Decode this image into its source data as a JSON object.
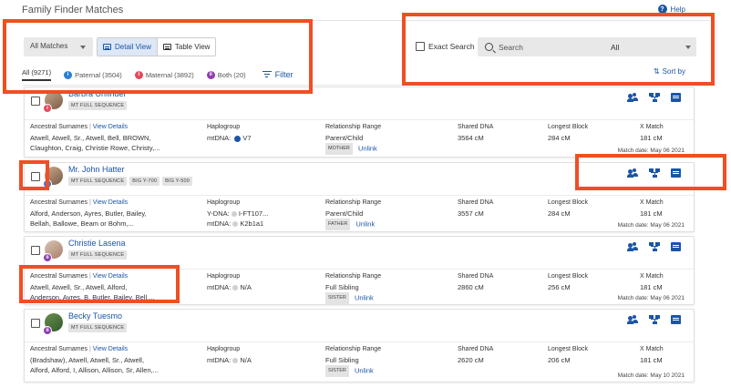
{
  "page": {
    "title": "Family Finder Matches",
    "help_label": "Help"
  },
  "toolbar": {
    "matches_dropdown": "All Matches",
    "detail_view": "Detail View",
    "table_view": "Table View",
    "exact_search_label": "Exact Search",
    "search_placeholder": "Search",
    "search_scope": "All",
    "sort_label": "Sort by",
    "filter_label": "Filter"
  },
  "tabs": [
    {
      "label": "All (9271)"
    },
    {
      "label": "Paternal (3504)",
      "color": "#2a7fd4"
    },
    {
      "label": "Maternal (3892)",
      "color": "#e34a5d"
    },
    {
      "label": "Both (20)",
      "color": "#8e3fae"
    }
  ],
  "column_labels": {
    "surnames": "Ancestral Surnames",
    "view_details": "View Details",
    "haplogroup": "Haplogroup",
    "relationship": "Relationship Range",
    "shared": "Shared DNA",
    "block": "Longest Block",
    "xmatch": "X Match",
    "unlink": "Unlink"
  },
  "matches": [
    {
      "name": "Barbra Unfinder",
      "tags": [
        "MT FULL SEQUENCE"
      ],
      "surnames_1": "Atwell, Atwell, Sr., Atwell, Bell, BROWN,",
      "surnames_2": "Claughton, Craig, Christie Rowe, Christy,...",
      "hap_1": "mtDNA:",
      "hap_1_val": "V7",
      "rel_1": "Parent/Child",
      "rel_badge": "MOTHER",
      "shared": "3564 cM",
      "block": "284 cM",
      "xmatch": "181 cM",
      "date": "Match date: May 06 2021",
      "badge": "i",
      "badge_color": "#e34a5d"
    },
    {
      "name": "Mr. John Hatter",
      "tags": [
        "MT FULL SEQUENCE",
        "BIG Y-700",
        "BIG Y-500"
      ],
      "surnames_1": "Alford, Anderson, Ayres, Butler, Bailey,",
      "surnames_2": "Bellah, Ballowe, Beam or Bohm,...",
      "hap_1": "Y-DNA:",
      "hap_1_val": "I-FT107...",
      "hap_2": "mtDNA:",
      "hap_2_val": "K2b1a1",
      "rel_1": "Parent/Child",
      "rel_badge": "FATHER",
      "shared": "3557 cM",
      "block": "284 cM",
      "xmatch": "181 cM",
      "date": "Match date: May 06 2021",
      "badge": "i",
      "badge_color": "#2a7fd4"
    },
    {
      "name": "Christie Lasena",
      "tags": [
        "MT FULL SEQUENCE"
      ],
      "surnames_1": "Atwell, Atwell, Sr., Atwell, Alford,",
      "surnames_2": "Anderson, Ayres, B, Butler, Bailey, Bell,...",
      "hap_1": "mtDNA:",
      "hap_1_val": "N/A",
      "rel_1": "Full Sibling",
      "rel_badge": "SISTER",
      "shared": "2860 cM",
      "block": "256 cM",
      "xmatch": "181 cM",
      "date": "Match date: May 06 2021",
      "badge": "ii",
      "badge_color": "#8e3fae"
    },
    {
      "name": "Becky Tuesmo",
      "tags": [
        "MT FULL SEQUENCE"
      ],
      "surnames_1": "(Bradshaw), Atwell, Atwell, Sr., Atwell,",
      "surnames_2": "Alford, Alford, I, Allison, Allison, Sr, Allen,...",
      "hap_1": "mtDNA:",
      "hap_1_val": "N/A",
      "rel_1": "Full Sibling",
      "rel_badge": "SISTER",
      "shared": "2620 cM",
      "block": "206 cM",
      "xmatch": "181 cM",
      "date": "Match date: May 10 2021",
      "badge": "ii",
      "badge_color": "#8e3fae"
    }
  ]
}
